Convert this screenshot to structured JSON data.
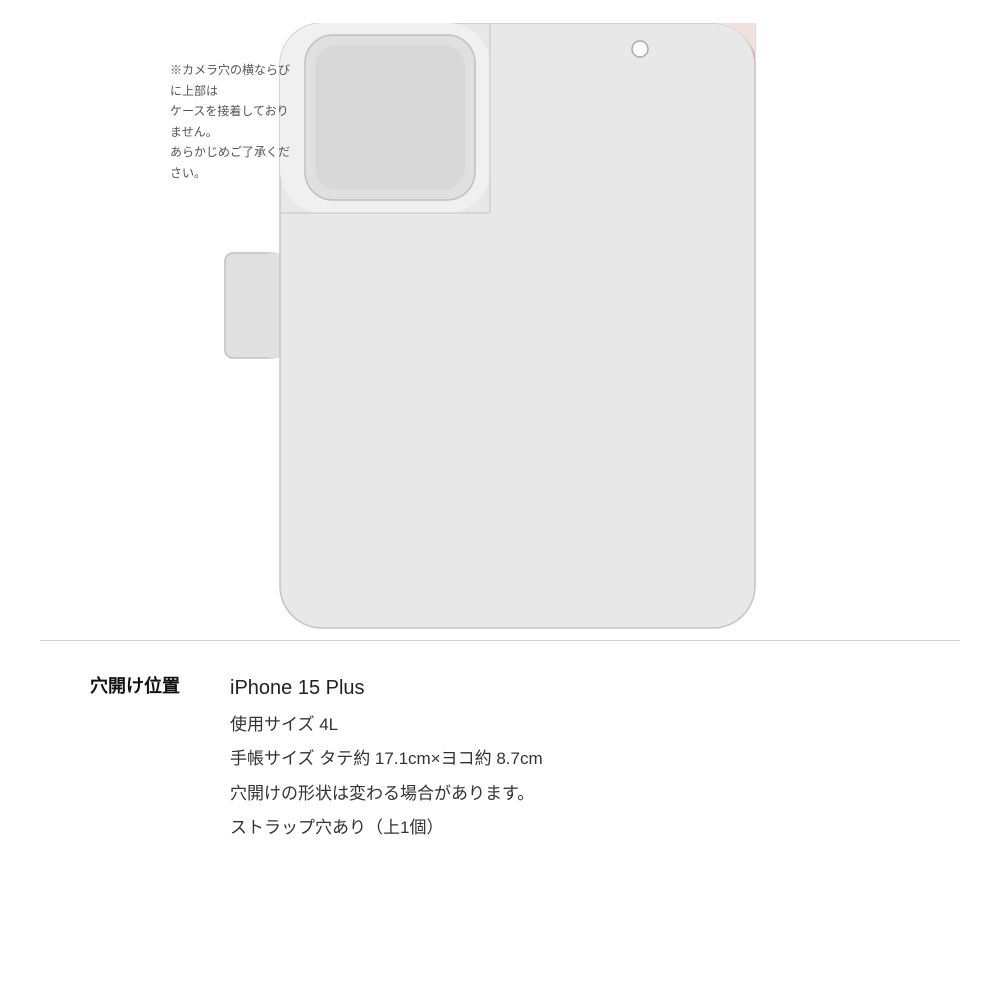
{
  "page": {
    "background_color": "#ffffff"
  },
  "camera_note": {
    "text": "※カメラ穴の横ならびに上部は\nケースを接着しておりません。\nあらかじめご了承ください。"
  },
  "hole_label": "穴開け位置",
  "specs": {
    "device_name": "iPhone 15 Plus",
    "size_label": "使用サイズ 4L",
    "notebook_size": "手帳サイズ タテ約 17.1cm×ヨコ約 8.7cm",
    "hole_shape_note": "穴開けの形状は変わる場合があります。",
    "strap_note": "ストラップ穴あり（上1個）"
  }
}
